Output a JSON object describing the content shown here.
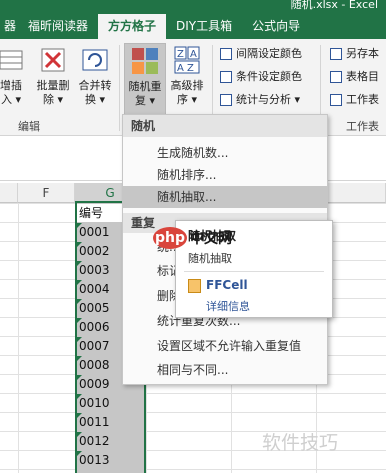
{
  "window": {
    "title": "随机.xlsx - Excel"
  },
  "tabs": [
    "福昕阅读器",
    "方方格子",
    "DIY工具箱",
    "公式向导"
  ],
  "ribbon": {
    "left_btn1": "增插\n入 ▾",
    "left_btn2": "批量删\n除 ▾",
    "left_btn3": "合并转\n换 ▾",
    "random_repeat": "随机重\n复 ▾",
    "advanced_sort": "高级排\n序 ▾",
    "group_edit": "编辑",
    "color_alt": "间隔设定颜色",
    "color_cond": "条件设定颜色",
    "stats": "统计与分析 ▾",
    "save_as": "另存本",
    "table_dir": "表格目",
    "worksheet": "工作表",
    "group_worksheet": "工作表"
  },
  "columns": {
    "f": "F",
    "g": "G"
  },
  "cells": [
    "编号",
    "0001",
    "0002",
    "0003",
    "0004",
    "0005",
    "0006",
    "0007",
    "0008",
    "0009",
    "0010",
    "0011",
    "0012",
    "0013"
  ],
  "menu": {
    "header": "随机",
    "items": [
      "生成随机数...",
      "随机排序...",
      "随机抽取...",
      "重复",
      "统...",
      "标记...",
      "删除...",
      "统计重复次数...",
      "设置区域不允许输入重复值",
      "相同与不同..."
    ]
  },
  "tooltip": {
    "title": "随机抽取",
    "desc": "随机抽取",
    "brand": "FFCell",
    "info": "详细信息"
  },
  "watermarks": {
    "php": "php",
    "cn": "中文网",
    "site": "软件技巧"
  },
  "colors": {
    "accent": "#217346",
    "link": "#2f5597"
  }
}
